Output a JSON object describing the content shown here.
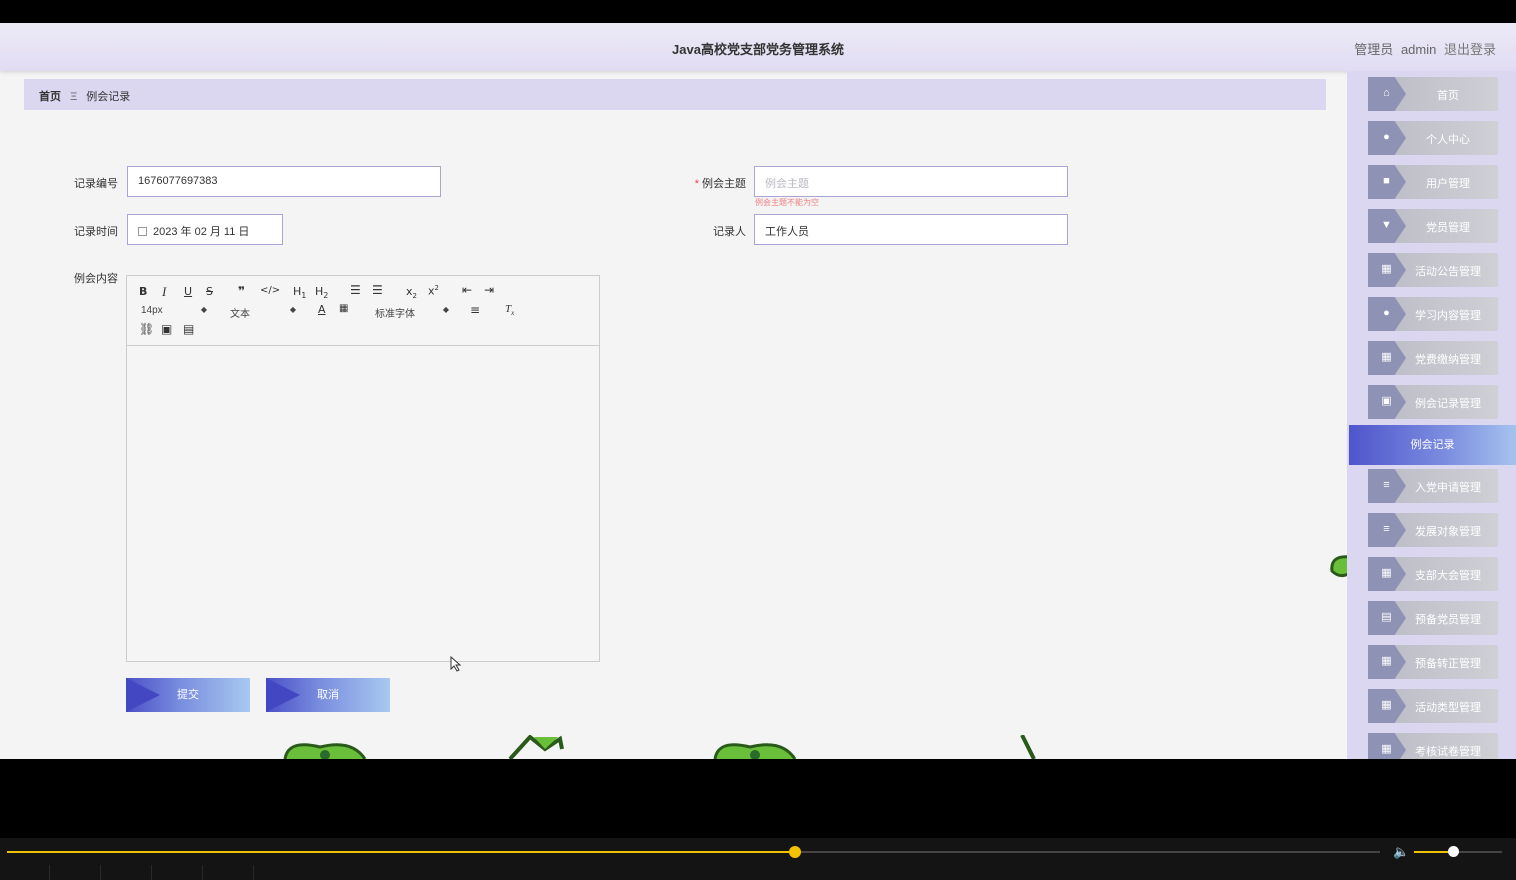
{
  "app": {
    "title": "Java高校党支部党务管理系统",
    "role": "管理员",
    "username": "admin",
    "logout": "退出登录"
  },
  "breadcrumb": {
    "home": "首页",
    "separator": "Ξ",
    "current": "例会记录"
  },
  "form": {
    "record_no_label": "记录编号",
    "record_no_value": "1676077697383",
    "topic_label": "例会主题",
    "topic_placeholder": "例会主题",
    "topic_error": "例会主题不能为空",
    "time_label": "记录时间",
    "time_value": "2023 年 02 月 11 日",
    "recorder_label": "记录人",
    "recorder_value": "工作人员",
    "content_label": "例会内容",
    "submit": "提交",
    "cancel": "取消"
  },
  "editor": {
    "font_size": "14px",
    "block_format": "文本",
    "font_family": "标准字体",
    "buttons": [
      "B",
      "I",
      "U",
      "S",
      "99",
      "</>",
      "H1",
      "H2",
      "ordered-list",
      "bullet-list",
      "x2",
      "x2",
      "outdent",
      "indent",
      "font-color",
      "background",
      "align",
      "clear-format",
      "link",
      "image",
      "video"
    ]
  },
  "sidebar": {
    "items": [
      {
        "label": "首页",
        "icon": "home-icon"
      },
      {
        "label": "个人中心",
        "icon": "user-icon"
      },
      {
        "label": "用户管理",
        "icon": "briefcase-icon"
      },
      {
        "label": "党员管理",
        "icon": "trophy-icon"
      },
      {
        "label": "活动公告管理",
        "icon": "grid-icon"
      },
      {
        "label": "学习内容管理",
        "icon": "bulb-icon"
      },
      {
        "label": "党费缴纳管理",
        "icon": "grid-icon"
      },
      {
        "label": "例会记录管理",
        "icon": "chart-icon"
      },
      {
        "label": "入党申请管理",
        "icon": "list-icon"
      },
      {
        "label": "发展对象管理",
        "icon": "list-icon"
      },
      {
        "label": "支部大会管理",
        "icon": "grid-icon"
      },
      {
        "label": "预备党员管理",
        "icon": "clipboard-icon"
      },
      {
        "label": "预备转正管理",
        "icon": "table-icon"
      },
      {
        "label": "活动类型管理",
        "icon": "grid-icon"
      },
      {
        "label": "考核试卷管理",
        "icon": "grid-icon"
      }
    ],
    "active_item": "例会记录"
  },
  "player": {
    "progress": 0.574,
    "volume": 0.44
  },
  "colors": {
    "accent": "#4f55cc",
    "header": "#e1dcf3",
    "breadcrumb": "#dcd7f1",
    "progress": "#f2c200"
  }
}
